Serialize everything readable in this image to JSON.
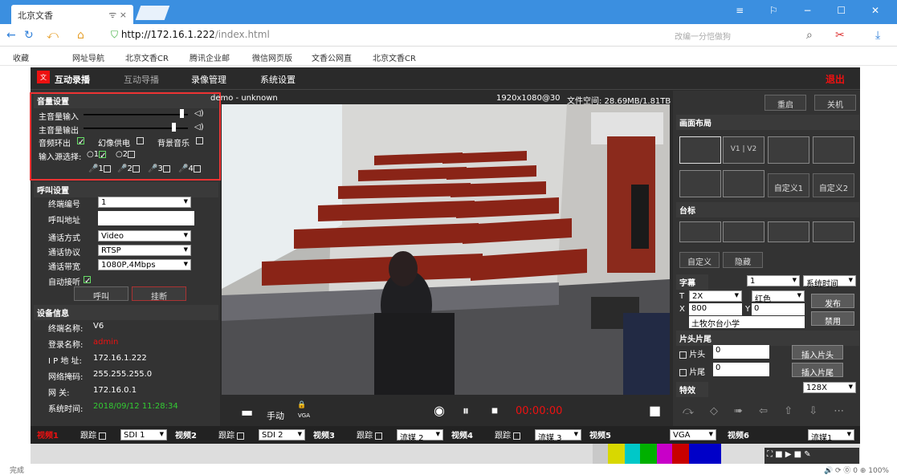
{
  "browser": {
    "tab_title": "北京文香",
    "tab_icons": "ᯤ ×",
    "url_host": "http://172.16.1.222",
    "url_path": "/index.html",
    "search_placeholder": "改编一分恺做狗",
    "win_controls": "≡ ⚐ − ☐ ✕"
  },
  "bookmarks": [
    "收藏",
    "网址导航",
    "北京文香CR",
    "腾讯企业邮",
    "微信网页版",
    "文香公网直",
    "北京文香CR"
  ],
  "app": {
    "logo": "北京文香",
    "tabs": [
      "互动录播",
      "互动导播",
      "录像管理",
      "系统设置"
    ],
    "logout": "退出"
  },
  "audio": {
    "header": "音量设置",
    "main_in": "主音量输入",
    "main_out": "主音量输出",
    "loop": "音频环出",
    "phantom": "幻像供电",
    "bgm": "背景音乐",
    "src": "输入源选择:",
    "src1": "1",
    "src2": "2",
    "mics": [
      "1",
      "2",
      "3",
      "4"
    ],
    "main_in_level": 0.88,
    "main_out_level": 0.83
  },
  "call": {
    "header": "呼叫设置",
    "terminal_no_label": "终端编号",
    "terminal_no": "1",
    "addr_label": "呼叫地址",
    "mode_label": "通话方式",
    "mode": "Video",
    "proto_label": "通话协议",
    "proto": "RTSP",
    "bw_label": "通话带宽",
    "bw": "1080P,4Mbps",
    "auto": "自动接听",
    "call_btn": "呼叫",
    "hang_btn": "挂断"
  },
  "device": {
    "header": "设备信息",
    "rows": [
      [
        "终端名称:",
        "V6"
      ],
      [
        "登录名称:",
        "admin"
      ],
      [
        "I P 地 址:",
        "172.16.1.222"
      ],
      [
        "网络掩码:",
        "255.255.255.0"
      ],
      [
        "网    关:",
        "172.16.0.1"
      ],
      [
        "系统时间:",
        "2018/09/12 11:28:34"
      ]
    ]
  },
  "video": {
    "title": "demo - unknown",
    "res": "1920x1080@30",
    "space": "文件空间: 28.69MB/1.81TB",
    "manual": "手动",
    "time": "00:00:00",
    "vga": "VGA"
  },
  "right": {
    "restart": "重启",
    "shutdown": "关机",
    "layout_header": "画面布局",
    "v1v2": "V1 | V2",
    "custom1": "自定义1",
    "custom2": "自定义2",
    "platform": "台标",
    "custom": "自定义",
    "hide": "隐藏",
    "caption": "字幕",
    "cap_no": "1",
    "systime": "系统时间",
    "size": "2X",
    "color": "红色",
    "x_val": "800",
    "y_val": "0",
    "text": "土牧尔台小学",
    "publish": "发布",
    "disable": "禁用",
    "headtail": "片头片尾",
    "head": "片头",
    "tail": "片尾",
    "hv": "0",
    "tv": "0",
    "ins_head": "插入片头",
    "ins_tail": "插入片尾",
    "effects": "特效",
    "eff_speed": "128X"
  },
  "strip": [
    {
      "label": "视频1",
      "track": "跟踪",
      "src": "SDI 1"
    },
    {
      "label": "视频2",
      "track": "跟踪",
      "src": "SDI 2"
    },
    {
      "label": "视频3",
      "track": "跟踪",
      "src": "流媒 2"
    },
    {
      "label": "视频4",
      "track": "跟踪",
      "src": "流媒 3"
    },
    {
      "label": "视频5",
      "track": "",
      "src": "VGA"
    },
    {
      "label": "视频6",
      "track": "",
      "src": "流媒1"
    }
  ],
  "status": {
    "left": "完成",
    "right": "🔊  ⟳  ⓪ 0  ⊕ 100%"
  }
}
